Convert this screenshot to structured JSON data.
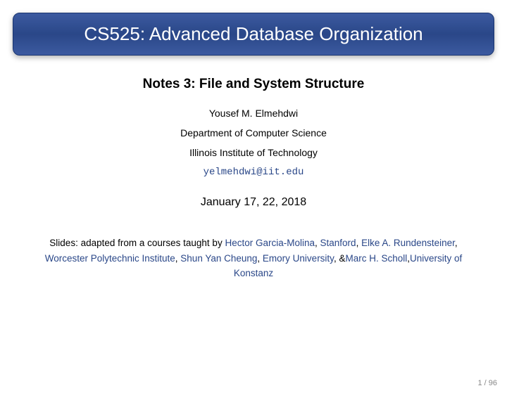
{
  "title": "CS525: Advanced Database Organization",
  "subtitle": "Notes 3: File and System Structure",
  "author": "Yousef M. Elmehdwi",
  "department": "Department of Computer Science",
  "institution": "Illinois Institute of Technology",
  "email": "yelmehdwi@iit.edu",
  "date": "January 17, 22, 2018",
  "credits": {
    "prefix": "Slides: adapted from a courses taught by ",
    "p1": "Hector Garcia-Molina",
    "c1": ", ",
    "p2": "Stanford",
    "c2": ", ",
    "p3": "Elke A. Rundensteiner",
    "c3": ", ",
    "p4": "Worcester Polytechnic Institute",
    "c4": ", ",
    "p5": "Shun Yan Cheung",
    "c5": ", ",
    "p6": "Emory University",
    "c6": ", &",
    "p7": "Marc H. Scholl",
    "c7": ",",
    "p8": "University of Konstanz"
  },
  "page": "1 / 96"
}
